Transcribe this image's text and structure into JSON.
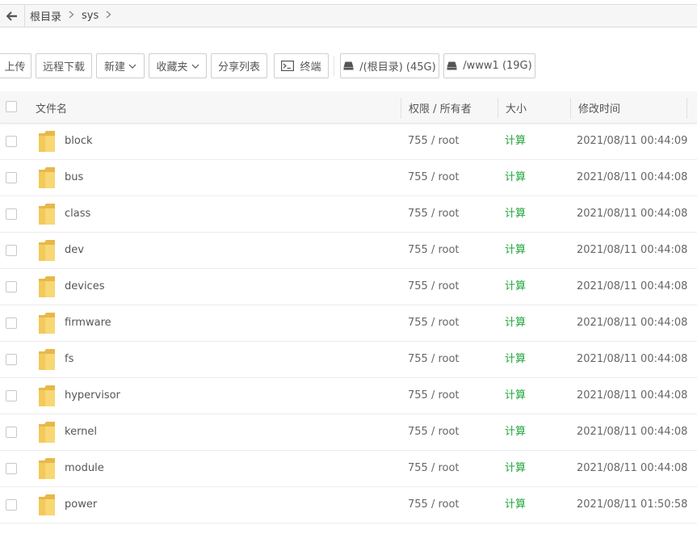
{
  "path_bar": {
    "crumbs": [
      "根目录",
      "sys"
    ]
  },
  "toolbar": {
    "upload": "上传",
    "remote_download": "远程下载",
    "new": "新建",
    "favorites": "收藏夹",
    "share_list": "分享列表",
    "terminal": "终端",
    "disk_root": "/(根目录) (45G)",
    "disk_www": "/www1 (19G)"
  },
  "table": {
    "headers": {
      "name": "文件名",
      "perm_owner": "权限 / 所有者",
      "size": "大小",
      "mtime": "修改时间"
    },
    "rows": [
      {
        "name": "block",
        "perm": "755 / root",
        "size": "计算",
        "mtime": "2021/08/11 00:44:09"
      },
      {
        "name": "bus",
        "perm": "755 / root",
        "size": "计算",
        "mtime": "2021/08/11 00:44:08"
      },
      {
        "name": "class",
        "perm": "755 / root",
        "size": "计算",
        "mtime": "2021/08/11 00:44:08"
      },
      {
        "name": "dev",
        "perm": "755 / root",
        "size": "计算",
        "mtime": "2021/08/11 00:44:08"
      },
      {
        "name": "devices",
        "perm": "755 / root",
        "size": "计算",
        "mtime": "2021/08/11 00:44:08"
      },
      {
        "name": "firmware",
        "perm": "755 / root",
        "size": "计算",
        "mtime": "2021/08/11 00:44:08"
      },
      {
        "name": "fs",
        "perm": "755 / root",
        "size": "计算",
        "mtime": "2021/08/11 00:44:08"
      },
      {
        "name": "hypervisor",
        "perm": "755 / root",
        "size": "计算",
        "mtime": "2021/08/11 00:44:08"
      },
      {
        "name": "kernel",
        "perm": "755 / root",
        "size": "计算",
        "mtime": "2021/08/11 00:44:08"
      },
      {
        "name": "module",
        "perm": "755 / root",
        "size": "计算",
        "mtime": "2021/08/11 00:44:08"
      },
      {
        "name": "power",
        "perm": "755 / root",
        "size": "计算",
        "mtime": "2021/08/11 01:50:58"
      }
    ]
  },
  "colors": {
    "accent_green": "#20a53a",
    "folder_yellow": "#f8d775"
  }
}
